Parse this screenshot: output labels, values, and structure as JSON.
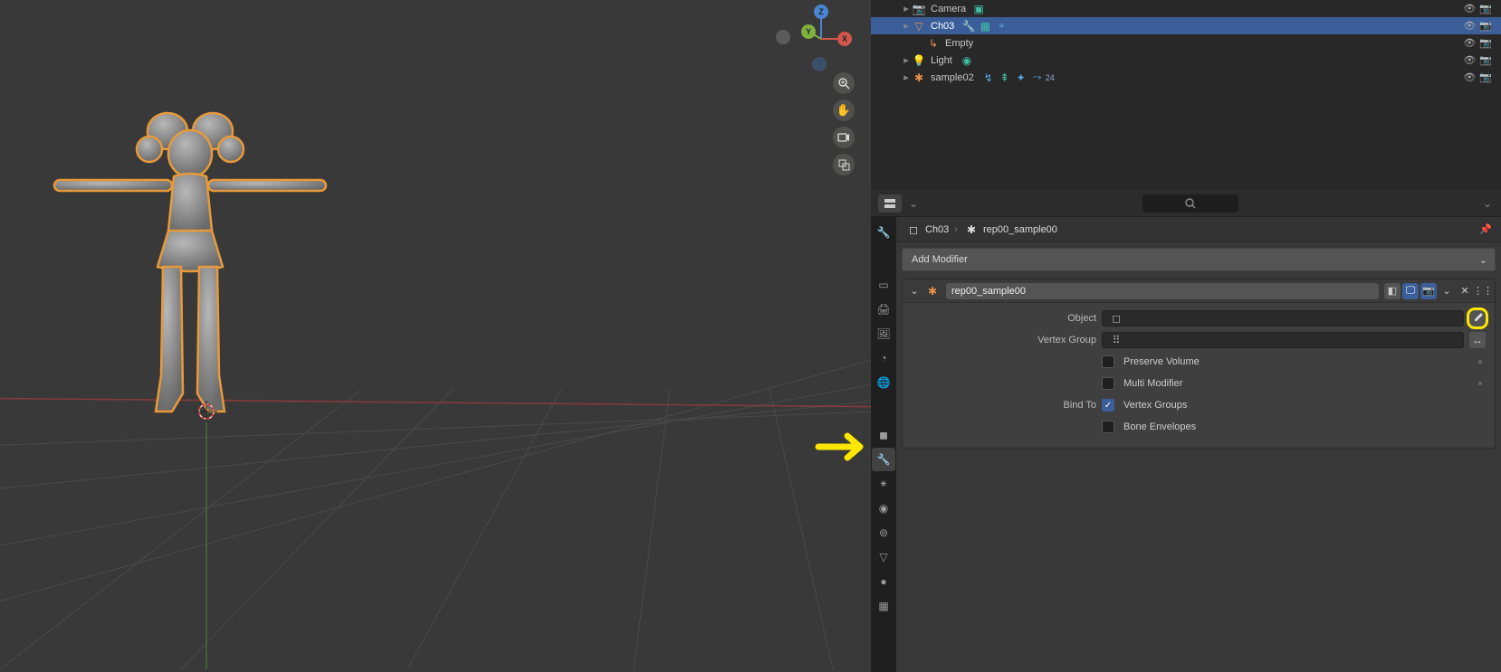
{
  "viewport": {
    "axes": {
      "x": "X",
      "y": "Y",
      "z": "Z"
    },
    "nav_buttons": {
      "zoom": "zoom",
      "pan": "pan",
      "camera": "camera",
      "ortho": "ortho"
    }
  },
  "outliner": {
    "items": [
      {
        "name": "Camera",
        "type": "camera",
        "indent": 28,
        "expander": "▸",
        "selected": false
      },
      {
        "name": "Ch03",
        "type": "mesh",
        "indent": 28,
        "expander": "▸",
        "selected": true,
        "badges": [
          "wrench",
          "data",
          "modifier"
        ]
      },
      {
        "name": "Empty",
        "type": "empty",
        "indent": 44,
        "expander": "",
        "selected": false
      },
      {
        "name": "Light",
        "type": "light",
        "indent": 28,
        "expander": "▸",
        "selected": false,
        "badges": [
          "bulb"
        ]
      },
      {
        "name": "sample02",
        "type": "armature",
        "indent": 28,
        "expander": "▸",
        "selected": false,
        "badges": [
          "arm",
          "pose",
          "bone",
          "count"
        ],
        "count": "24"
      }
    ]
  },
  "properties": {
    "search_placeholder": "",
    "breadcrumb": {
      "object": "Ch03",
      "modifier": "rep00_sample00"
    },
    "add_modifier_label": "Add Modifier",
    "modifier": {
      "name": "rep00_sample00",
      "fields": {
        "object_label": "Object",
        "object_value": "",
        "vertex_group_label": "Vertex Group",
        "vertex_group_value": "",
        "preserve_volume_label": "Preserve Volume",
        "preserve_volume": false,
        "multi_modifier_label": "Multi Modifier",
        "multi_modifier": false,
        "bind_to_label": "Bind To",
        "vertex_groups_label": "Vertex Groups",
        "vertex_groups": true,
        "bone_envelopes_label": "Bone Envelopes",
        "bone_envelopes": false
      }
    },
    "tabs": [
      "tool",
      "render",
      "output",
      "viewlayer",
      "scene",
      "world",
      "object",
      "modifier",
      "particles",
      "physics",
      "constraints",
      "data",
      "material",
      "texture"
    ],
    "active_tab": "modifier"
  }
}
